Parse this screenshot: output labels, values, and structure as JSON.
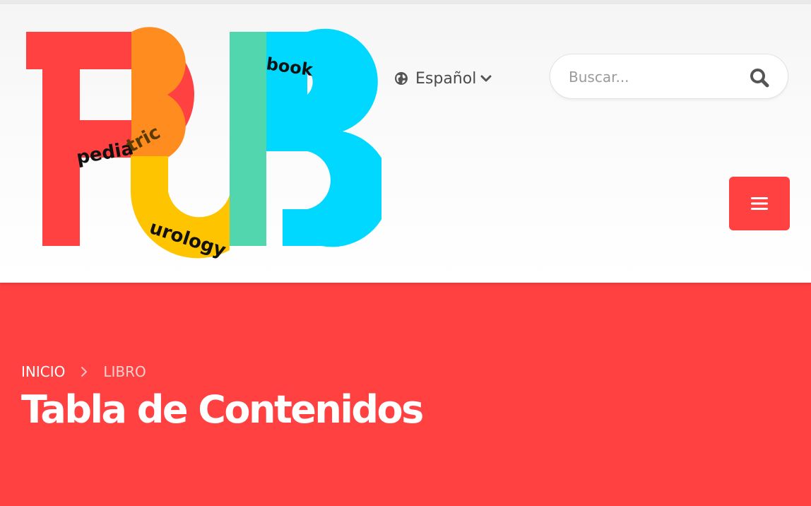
{
  "logo": {
    "big_letters": "PUB",
    "words": {
      "pedia": "pedia",
      "tric": "tric",
      "urology": "urology",
      "book": "book"
    },
    "colors": {
      "p_red": "#ff4141",
      "p_orange": "#ff8c1f",
      "u_yellow": "#ffc400",
      "u_green": "#52d6ae",
      "b_cyan": "#00d8ff"
    }
  },
  "language": {
    "label": "Español",
    "icon": "globe-icon",
    "dropdown_icon": "chevron-down-icon"
  },
  "search": {
    "placeholder": "Buscar...",
    "value": "",
    "icon": "search-icon"
  },
  "menu": {
    "icon": "hamburger-menu-icon"
  },
  "breadcrumb": {
    "home": "INICIO",
    "separator_icon": "chevron-right-icon",
    "current": "LIBRO"
  },
  "page": {
    "title": "Tabla de Contenidos"
  },
  "theme": {
    "accent": "#ff4141",
    "header_bg": "#f7f7f7",
    "text_gray": "#4a4a4a"
  }
}
